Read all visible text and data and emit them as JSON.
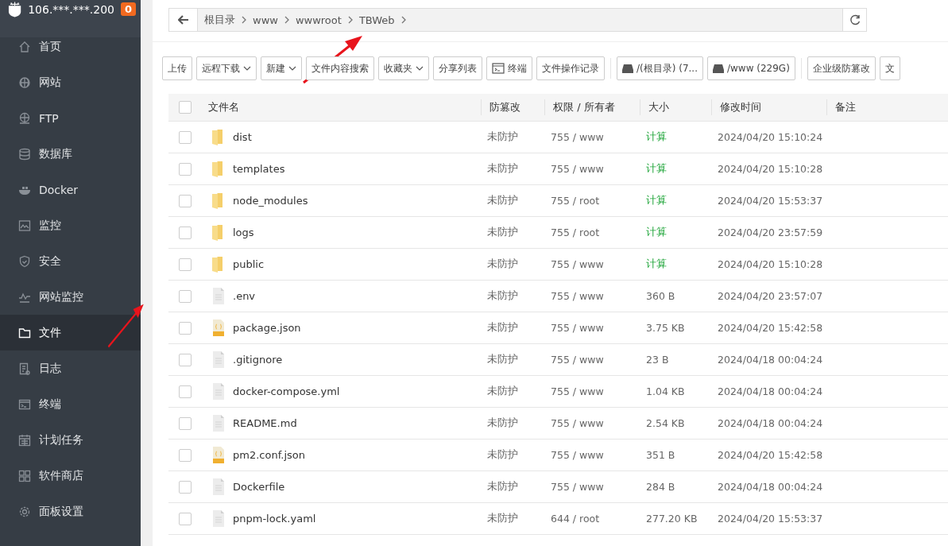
{
  "sidebar": {
    "host": "106.***.***.200",
    "badge": "0",
    "items": [
      {
        "label": "首页",
        "selected": false
      },
      {
        "label": "网站",
        "selected": false
      },
      {
        "label": "FTP",
        "selected": false
      },
      {
        "label": "数据库",
        "selected": false
      },
      {
        "label": "Docker",
        "selected": false
      },
      {
        "label": "监控",
        "selected": false
      },
      {
        "label": "安全",
        "selected": false
      },
      {
        "label": "网站监控",
        "selected": false
      },
      {
        "label": "文件",
        "selected": true
      },
      {
        "label": "日志",
        "selected": false
      },
      {
        "label": "终端",
        "selected": false
      },
      {
        "label": "计划任务",
        "selected": false
      },
      {
        "label": "软件商店",
        "selected": false
      },
      {
        "label": "面板设置",
        "selected": false
      }
    ]
  },
  "path": {
    "segments": [
      "根目录",
      "www",
      "wwwroot",
      "TBWeb"
    ]
  },
  "toolbar": [
    [
      {
        "label": "上传",
        "kind": "plain"
      },
      {
        "label": "远程下载",
        "kind": "dropdown"
      },
      {
        "label": "新建",
        "kind": "dropdown"
      },
      {
        "label": "文件内容搜索",
        "kind": "plain"
      },
      {
        "label": "收藏夹",
        "kind": "dropdown"
      },
      {
        "label": "分享列表",
        "kind": "plain"
      },
      {
        "label": "终端",
        "kind": "terminal"
      },
      {
        "label": "文件操作记录",
        "kind": "plain"
      }
    ],
    [
      {
        "label": "/(根目录) (7...",
        "kind": "disk"
      },
      {
        "label": "/www (229G)",
        "kind": "disk"
      }
    ],
    [
      {
        "label": "企业级防篡改",
        "kind": "plain"
      },
      {
        "label": "文",
        "kind": "plain"
      }
    ]
  ],
  "table": {
    "all_checked": false,
    "columns": [
      "文件名",
      "防篡改",
      "权限 / 所有者",
      "大小",
      "修改时间",
      "备注"
    ],
    "rows": [
      {
        "kind": "folder",
        "name": "dist",
        "protect": "未防护",
        "perm": "755 / www",
        "size": "计算",
        "size_is_link": true,
        "mtime": "2024/04/20 15:10:24",
        "checked": false
      },
      {
        "kind": "folder",
        "name": "templates",
        "protect": "未防护",
        "perm": "755 / www",
        "size": "计算",
        "size_is_link": true,
        "mtime": "2024/04/20 15:10:28",
        "checked": false
      },
      {
        "kind": "folder",
        "name": "node_modules",
        "protect": "未防护",
        "perm": "755 / root",
        "size": "计算",
        "size_is_link": true,
        "mtime": "2024/04/20 15:53:37",
        "checked": false
      },
      {
        "kind": "folder",
        "name": "logs",
        "protect": "未防护",
        "perm": "755 / root",
        "size": "计算",
        "size_is_link": true,
        "mtime": "2024/04/20 23:57:59",
        "checked": false
      },
      {
        "kind": "folder",
        "name": "public",
        "protect": "未防护",
        "perm": "755 / www",
        "size": "计算",
        "size_is_link": true,
        "mtime": "2024/04/20 15:10:28",
        "checked": false
      },
      {
        "kind": "file",
        "name": ".env",
        "protect": "未防护",
        "perm": "755 / www",
        "size": "360 B",
        "size_is_link": false,
        "mtime": "2024/04/20 23:57:07",
        "checked": false
      },
      {
        "kind": "json",
        "name": "package.json",
        "protect": "未防护",
        "perm": "755 / www",
        "size": "3.75 KB",
        "size_is_link": false,
        "mtime": "2024/04/20 15:42:58",
        "checked": false
      },
      {
        "kind": "file",
        "name": ".gitignore",
        "protect": "未防护",
        "perm": "755 / www",
        "size": "23 B",
        "size_is_link": false,
        "mtime": "2024/04/18 00:04:24",
        "checked": false
      },
      {
        "kind": "file",
        "name": "docker-compose.yml",
        "protect": "未防护",
        "perm": "755 / www",
        "size": "1.04 KB",
        "size_is_link": false,
        "mtime": "2024/04/18 00:04:24",
        "checked": false
      },
      {
        "kind": "file",
        "name": "README.md",
        "protect": "未防护",
        "perm": "755 / www",
        "size": "2.54 KB",
        "size_is_link": false,
        "mtime": "2024/04/18 00:04:24",
        "checked": false
      },
      {
        "kind": "json",
        "name": "pm2.conf.json",
        "protect": "未防护",
        "perm": "755 / www",
        "size": "351 B",
        "size_is_link": false,
        "mtime": "2024/04/20 15:42:58",
        "checked": false
      },
      {
        "kind": "file",
        "name": "Dockerfile",
        "protect": "未防护",
        "perm": "755 / www",
        "size": "284 B",
        "size_is_link": false,
        "mtime": "2024/04/18 00:04:24",
        "checked": false
      },
      {
        "kind": "file",
        "name": "pnpm-lock.yaml",
        "protect": "未防护",
        "perm": "644 / root",
        "size": "277.20 KB",
        "size_is_link": false,
        "mtime": "2024/04/20 15:53:37",
        "checked": false
      }
    ]
  },
  "annotations": [
    {
      "kind": "arrow"
    },
    {
      "kind": "arrow"
    }
  ]
}
